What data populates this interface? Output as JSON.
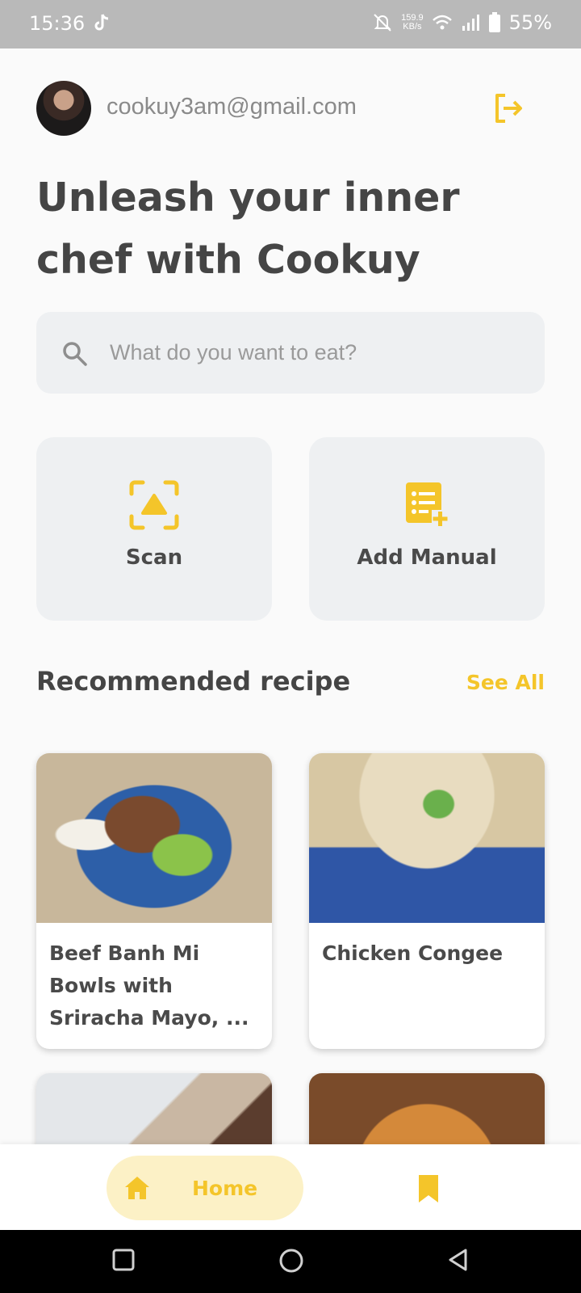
{
  "status_bar": {
    "time": "15:36",
    "net_speed_value": "159.9",
    "net_speed_unit": "KB/s",
    "battery": "55%",
    "icons": [
      "tiktok-icon",
      "mute-icon",
      "wifi-icon",
      "signal-icon",
      "battery-icon"
    ]
  },
  "header": {
    "email": "cookuy3am@gmail.com",
    "headline": "Unleash your inner chef with Cookuy"
  },
  "search": {
    "placeholder": "What do you want to eat?"
  },
  "actions": {
    "scan_label": "Scan",
    "manual_label": "Add Manual"
  },
  "recommended": {
    "title": "Recommended recipe",
    "see_all": "See All",
    "recipes": [
      {
        "title": "Beef Banh Mi Bowls with Sriracha Mayo, ..."
      },
      {
        "title": "Chicken Congee"
      }
    ]
  },
  "bottom_nav": {
    "home_label": "Home"
  },
  "colors": {
    "accent": "#f4c52a",
    "accent_soft": "#fcf1c6",
    "surface": "#eef0f2",
    "text": "#454545"
  }
}
